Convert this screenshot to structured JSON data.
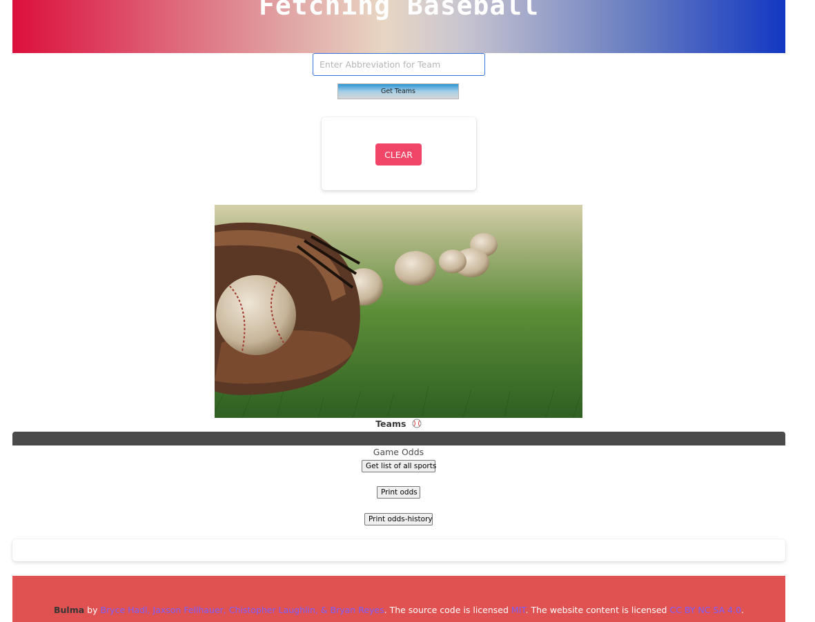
{
  "header": {
    "title": "Fetching Baseball",
    "gradient_colors": [
      "#dc0f3c",
      "#e8d6c3",
      "#1237c2"
    ]
  },
  "search": {
    "placeholder": "Enter Abbreviation for Team",
    "value": "",
    "button_label": "Get Teams"
  },
  "clear_card": {
    "button_label": "CLEAR",
    "button_color": "#f14668"
  },
  "teams": {
    "label": "Teams",
    "icon": "baseball-icon"
  },
  "odds": {
    "title": "Game Odds",
    "buttons": [
      "Get list of all sports",
      "Print odds",
      "Print odds-history"
    ]
  },
  "footer": {
    "brand": "Bulma",
    "by": "by",
    "authors": "Bryce Hadl, Jaxson Fellhauer, Chistopher Laughlin, & Bryan Reyes",
    "source_text": ". The source code is licensed",
    "license_code": "MIT",
    "content_text": ". The website content is licensed",
    "license_content": "CC BY NC SA 4.0",
    "end": ".",
    "background_color": "#e05252"
  }
}
